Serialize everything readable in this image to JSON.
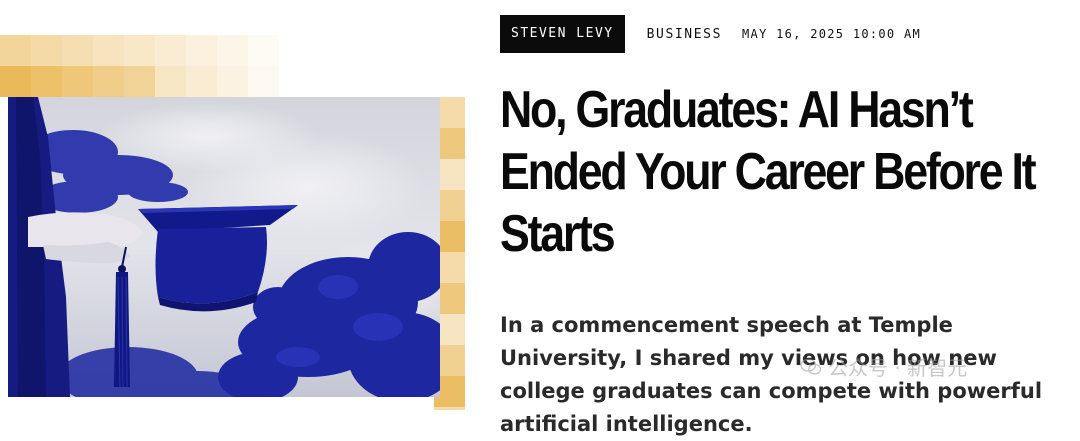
{
  "article": {
    "author": "STEVEN LEVY",
    "section": "BUSINESS",
    "date": "MAY 16, 2025 10:00 AM",
    "headline": "No, Graduates: AI Hasn’t Ended Your Career Before It Starts",
    "dek": "In a commencement speech at Temple University, I shared my views on how new college graduates can compete with powerful artificial intelligence."
  },
  "watermark": {
    "text": "公众号 · 新智元",
    "icon": "wechat-icon"
  },
  "hero": {
    "image": "graduate-holding-cap-photo",
    "colors": {
      "duotone_blue": "#1f2aa8",
      "mosaic_gold": "#e8b34a"
    }
  }
}
